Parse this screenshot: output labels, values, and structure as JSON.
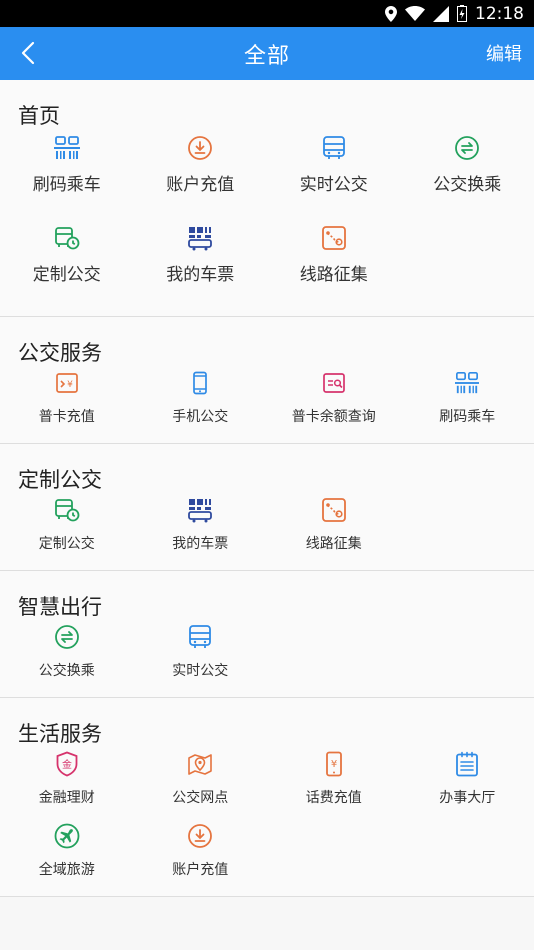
{
  "statusbar": {
    "time": "12:18"
  },
  "navbar": {
    "title": "全部",
    "edit_label": "编辑"
  },
  "colors": {
    "primary": "#2a8ef0",
    "blue": "#2f8be6",
    "orange": "#e5743f",
    "green": "#23a15d",
    "pink": "#d6336c"
  },
  "sections": [
    {
      "title": "首页",
      "items": [
        {
          "label": "刷码乘车",
          "icon": "qr-scan-icon"
        },
        {
          "label": "账户充值",
          "icon": "download-circle-icon"
        },
        {
          "label": "实时公交",
          "icon": "bus-icon"
        },
        {
          "label": "公交换乘",
          "icon": "transfer-icon"
        },
        {
          "label": "定制公交",
          "icon": "custom-bus-clock-icon"
        },
        {
          "label": "我的车票",
          "icon": "ticket-qr-icon"
        },
        {
          "label": "线路征集",
          "icon": "route-map-icon"
        }
      ]
    },
    {
      "title": "公交服务",
      "items": [
        {
          "label": "普卡充值",
          "icon": "card-recharge-icon"
        },
        {
          "label": "手机公交",
          "icon": "phone-icon"
        },
        {
          "label": "普卡余额查询",
          "icon": "card-balance-icon"
        },
        {
          "label": "刷码乘车",
          "icon": "qr-scan-icon"
        }
      ]
    },
    {
      "title": "定制公交",
      "items": [
        {
          "label": "定制公交",
          "icon": "custom-bus-clock-icon"
        },
        {
          "label": "我的车票",
          "icon": "ticket-qr-icon"
        },
        {
          "label": "线路征集",
          "icon": "route-map-icon"
        }
      ]
    },
    {
      "title": "智慧出行",
      "items": [
        {
          "label": "公交换乘",
          "icon": "transfer-icon"
        },
        {
          "label": "实时公交",
          "icon": "bus-icon"
        }
      ]
    },
    {
      "title": "生活服务",
      "items": [
        {
          "label": "金融理财",
          "icon": "finance-shield-icon"
        },
        {
          "label": "公交网点",
          "icon": "map-pin-icon"
        },
        {
          "label": "话费充值",
          "icon": "phone-bill-icon"
        },
        {
          "label": "办事大厅",
          "icon": "notepad-icon"
        },
        {
          "label": "全域旅游",
          "icon": "plane-icon"
        },
        {
          "label": "账户充值",
          "icon": "download-circle-icon"
        }
      ]
    }
  ]
}
